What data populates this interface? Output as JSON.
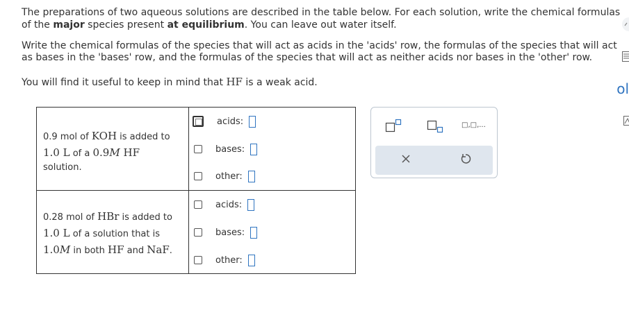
{
  "instructions": {
    "p1_part1": "The preparations of two aqueous solutions are described in the table below. For each solution, write the chemical formulas",
    "p1_part2_a": "of the ",
    "p1_bold1": "major",
    "p1_part2_b": " species present ",
    "p1_bold2": "at equilibrium",
    "p1_part2_c": ". You can leave out water itself.",
    "p2_line1": "Write the chemical formulas of the species that will act as acids in the 'acids' row, the formulas of the species that will act",
    "p2_line2": "as bases in the 'bases' row, and the formulas of the species that will act as neither acids nor bases in the 'other' row.",
    "p3_a": "You will find it useful to keep in mind that ",
    "p3_math": "HF",
    "p3_b": " is a weak acid."
  },
  "solutions": [
    {
      "desc": {
        "t1": "0.9 mol of ",
        "m1": "KOH",
        "t2": " is added to",
        "m2": "1.0 L",
        "t3": " of a ",
        "m3": "0.9",
        "m3_unit": "M",
        "m4": " HF",
        "t4": "solution."
      },
      "rows": [
        {
          "label": "acids:"
        },
        {
          "label": "bases:"
        },
        {
          "label": "other:"
        }
      ]
    },
    {
      "desc": {
        "t1": "0.28 mol of ",
        "m1": "HBr",
        "t2": " is added to",
        "m2": "1.0 L",
        "t3": " of a solution that is",
        "m3": "1.0",
        "m3_unit": "M",
        "t4": " in both ",
        "m4": "HF",
        "t5": " and ",
        "m5": "NaF",
        "t6": "."
      },
      "rows": [
        {
          "label": "acids:"
        },
        {
          "label": "bases:"
        },
        {
          "label": "other:"
        }
      ]
    }
  ],
  "palette": {
    "buttons": [
      "superscript-box",
      "subscript-box",
      "comma-list"
    ],
    "comma_list_text": "□,□,...",
    "clear": "×",
    "reset": "undo"
  },
  "edge": {
    "dl": "ol"
  }
}
